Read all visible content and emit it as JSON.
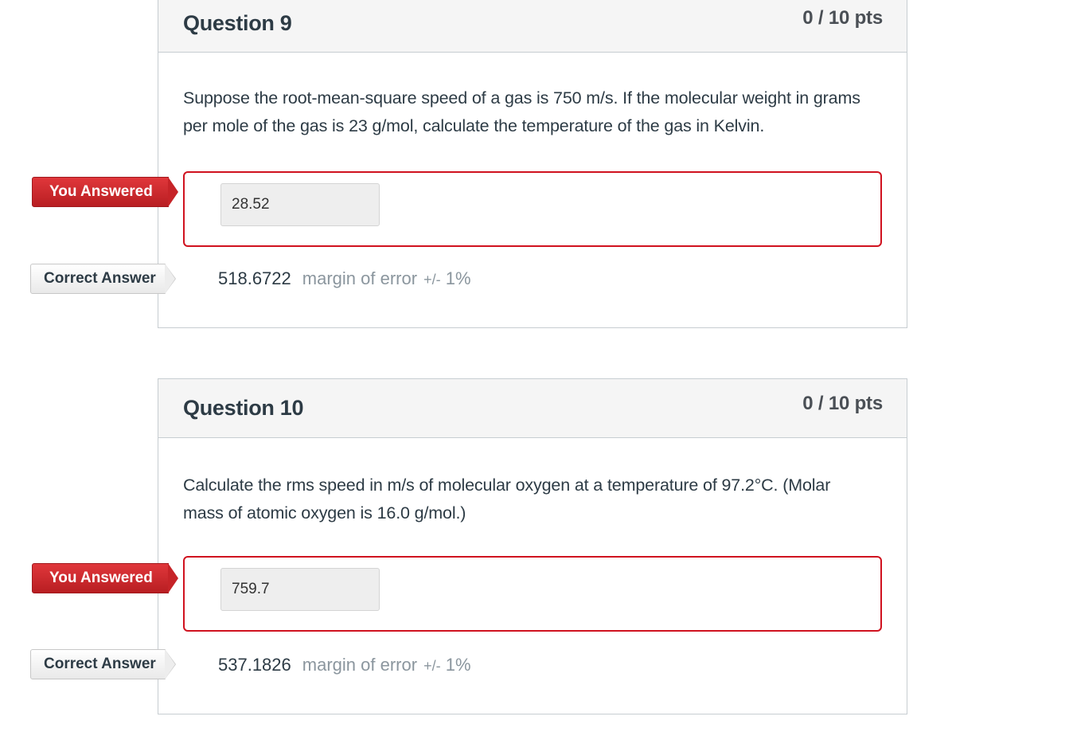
{
  "questions": [
    {
      "title": "Question 9",
      "points": "0 / 10 pts",
      "text": "Suppose the root-mean-square speed of a gas is 750 m/s. If the molecular weight in grams per mole of the gas is 23 g/mol, calculate the temperature of the gas in Kelvin.",
      "you_answered_label": "You Answered",
      "your_answer": "28.52",
      "correct_answer_label": "Correct Answer",
      "correct_answer": "518.6722",
      "margin_label": "margin of error",
      "margin_value_prefix": "+/-",
      "margin_value": " 1%"
    },
    {
      "title": "Question 10",
      "points": "0 / 10 pts",
      "text": "Calculate the rms speed in m/s of molecular oxygen at a temperature of 97.2°C. (Molar mass of atomic oxygen is 16.0 g/mol.)",
      "you_answered_label": "You Answered",
      "your_answer": "759.7",
      "correct_answer_label": "Correct Answer",
      "correct_answer": "537.1826",
      "margin_label": "margin of error",
      "margin_value_prefix": "+/-",
      "margin_value": " 1%"
    }
  ],
  "colors": {
    "incorrect": "#d0121f",
    "header_bg": "#f5f5f5",
    "text": "#2d3b45",
    "muted": "#8b969e"
  }
}
